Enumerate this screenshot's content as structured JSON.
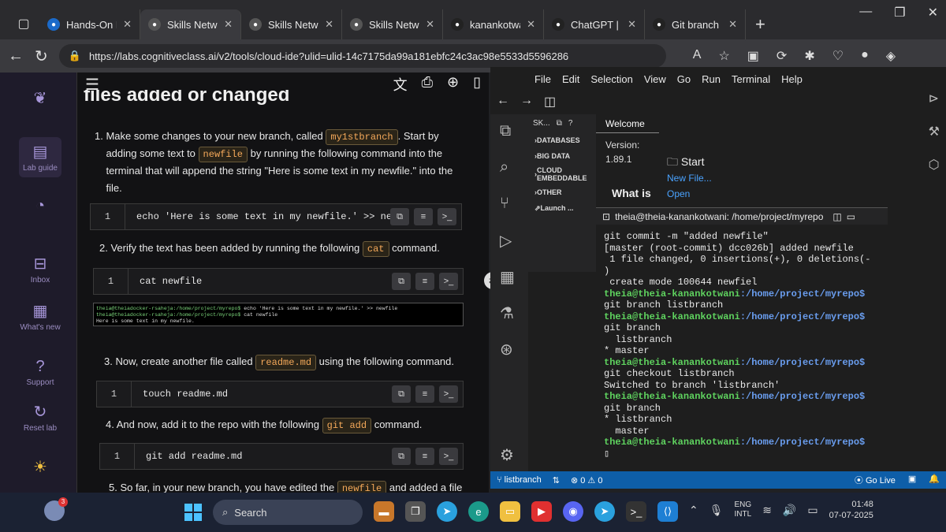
{
  "browser": {
    "tabs": [
      {
        "label": "Hands-On Lab:",
        "icon": "cognitiveclass-icon",
        "color": "#1b6ac9"
      },
      {
        "label": "Skills Network L",
        "icon": "skillsnetwork-icon",
        "color": "#555",
        "active": true
      },
      {
        "label": "Skills Network E",
        "icon": "skillsnetwork-icon",
        "color": "#555"
      },
      {
        "label": "Skills Network E",
        "icon": "skillsnetwork-icon",
        "color": "#555"
      },
      {
        "label": "kanankotwani28",
        "icon": "github-icon",
        "color": "#222"
      },
      {
        "label": "ChatGPT | Open",
        "icon": "chatgpt-icon",
        "color": "#222"
      },
      {
        "label": "Git branch error",
        "icon": "chatgpt-icon",
        "color": "#222"
      }
    ],
    "new_tab": "+",
    "url": "https://labs.cognitiveclass.ai/v2/tools/cloud-ide?ulid=ulid-14c7175da99a181ebfc24c3ac98e5533d5596286"
  },
  "rail": {
    "items": [
      {
        "label": "Lab guide",
        "icon": "document-icon"
      },
      {
        "label": "",
        "icon": "chat-icon"
      },
      {
        "label": "Inbox",
        "icon": "inbox-icon"
      },
      {
        "label": "What's new",
        "icon": "news-icon"
      },
      {
        "label": "Support",
        "icon": "help-icon"
      },
      {
        "label": "Reset lab",
        "icon": "reset-icon"
      },
      {
        "label": "",
        "icon": "theme-icon"
      }
    ]
  },
  "guide": {
    "heading": "files added or changed",
    "step1_a": "1. Make some changes to your new branch, called",
    "step1_code1": "my1stbranch",
    "step1_b": ". Start by",
    "step1_c": "adding some text to",
    "step1_code2": "newfile",
    "step1_d": "by running the following command into the",
    "step1_e": "terminal that will append the string \"Here is some text in my newfile.\" into the",
    "step1_f": "file.",
    "cmd1": "echo 'Here is some text in my newfile.' >> newf",
    "step2_a": "2. Verify the text has been added by running the following",
    "step2_code": "cat",
    "step2_b": "command.",
    "cmd2": "cat newfile",
    "shot_l1_prompt": "theia@theiadocker-rsaheja:/home/project/myrepo$",
    "shot_l1_cmd": " echo 'Here is some text in my newfile.' >> newfile",
    "shot_l2_prompt": "theia@theiadocker-rsaheja:/home/project/myrepo$",
    "shot_l2_cmd": " cat newfile",
    "shot_l3": "Here is some text in my newfile.",
    "step3_a": "3. Now, create another file called",
    "step3_code": "readme.md",
    "step3_b": "using the following command.",
    "cmd3": "touch readme.md",
    "step4_a": "4. And now, add it to the repo with the following",
    "step4_code": "git add",
    "step4_b": "command.",
    "cmd4": "git add readme.md",
    "step5_a": "5. So far, in your new branch, you have edited the",
    "step5_code": "newfile",
    "step5_b": "and added a file",
    "line_num": "1"
  },
  "ide": {
    "menu": [
      "File",
      "Edit",
      "Selection",
      "View",
      "Go",
      "Run",
      "Terminal",
      "Help"
    ],
    "explorer_head": "SK...",
    "explorer_items": [
      "DATABASES",
      "BIG DATA",
      "CLOUD EMBEDDABLE",
      "OTHER",
      "Launch ..."
    ],
    "welcome_tab": "Welcome",
    "version_label": "Version:",
    "version": "1.89.1",
    "start": "Start",
    "new_file": "New File...",
    "open": "Open",
    "what_is": "What is",
    "terminal_title": "theia@theia-kanankotwani: /home/project/myrepo",
    "prompt": "theia@theia-kanankotwani",
    "path": ":/home/project/myrepo$",
    "lines": {
      "l1": "git commit -m \"added newfile\"",
      "l2": "[master (root-commit) dcc026b] added newfile",
      "l3": " 1 file changed, 0 insertions(+), 0 deletions(-",
      "l4": ")",
      "l5": " create mode 100644 newfiel",
      "c1": "git branch listbranch",
      "c2": "git branch",
      "o1": "  listbranch",
      "o2": "* master",
      "c3": "git checkout listbranch",
      "o3": "Switched to branch 'listbranch'",
      "c4": "git branch",
      "o4": "* listbranch",
      "o5": "  master"
    },
    "status_branch": "listbranch",
    "status_problems": "⊗ 0 ⚠ 0",
    "go_live": "Go Live"
  },
  "taskbar": {
    "weather_badge": "3",
    "search": "Search",
    "lang1": "ENG",
    "lang2": "INTL",
    "time": "01:48",
    "date": "07-07-2025"
  }
}
